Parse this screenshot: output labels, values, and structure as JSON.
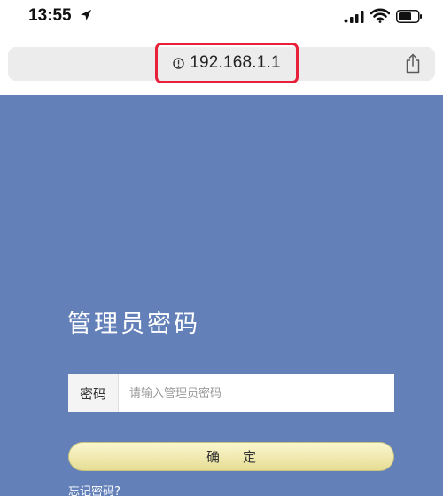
{
  "status_bar": {
    "time": "13:55",
    "icons": [
      "location-arrow-icon",
      "signal-icon",
      "wifi-icon",
      "battery-icon"
    ]
  },
  "browser": {
    "url": "192.168.1.1",
    "icons": [
      "info-icon",
      "share-icon"
    ],
    "highlight_color": "#e8203a"
  },
  "login": {
    "title": "管理员密码",
    "field_label": "密码",
    "placeholder": "请输入管理员密码",
    "value": "",
    "confirm_label": "确定",
    "forgot_link": "忘记密码?"
  },
  "colors": {
    "page_background": "#6380b9",
    "button_gradient_top": "#fbf7cf",
    "button_gradient_bottom": "#e5dd93"
  }
}
